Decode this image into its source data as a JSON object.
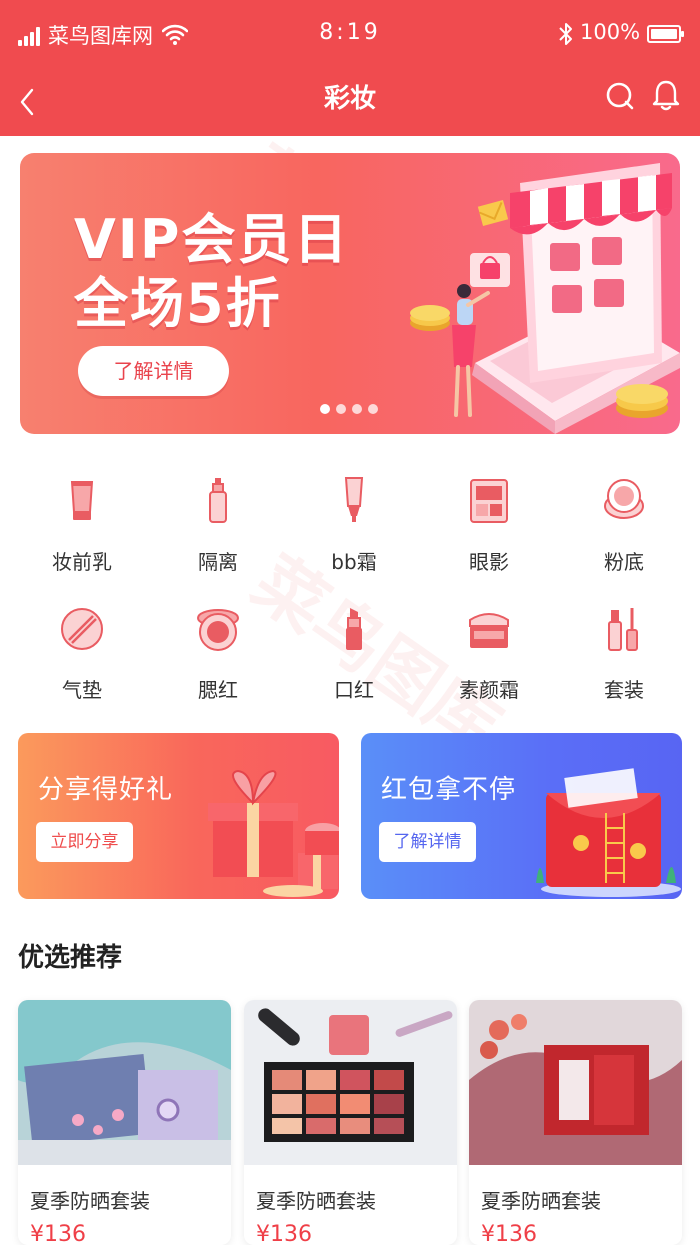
{
  "status_bar": {
    "carrier": "菜鸟图库网",
    "time": "8:19",
    "battery": "100%",
    "battery_level": 1.0
  },
  "header": {
    "title": "彩妆",
    "icons": [
      "back-icon",
      "search-icon",
      "bell-icon"
    ]
  },
  "banner": {
    "line1": "VIP会员日",
    "line2": "全场5折",
    "cta": "了解详情",
    "page_count": 4,
    "active_page": 1
  },
  "categories": [
    {
      "label": "妆前乳",
      "icon": "primer-tube-icon"
    },
    {
      "label": "隔离",
      "icon": "isolation-bottle-icon"
    },
    {
      "label": "bb霜",
      "icon": "bb-cream-icon"
    },
    {
      "label": "眼影",
      "icon": "eyeshadow-palette-icon"
    },
    {
      "label": "粉底",
      "icon": "foundation-compact-icon"
    },
    {
      "label": "气垫",
      "icon": "cushion-icon"
    },
    {
      "label": "腮红",
      "icon": "blush-icon"
    },
    {
      "label": "口红",
      "icon": "lipstick-icon"
    },
    {
      "label": "素颜霜",
      "icon": "cream-jar-icon"
    },
    {
      "label": "套装",
      "icon": "set-icon"
    }
  ],
  "promos": [
    {
      "title": "分享得好礼",
      "button": "立即分享"
    },
    {
      "title": "红包拿不停",
      "button": "了解详情"
    }
  ],
  "section": {
    "title": "优选推荐"
  },
  "products": [
    {
      "name": "夏季防晒套装",
      "price": "¥136"
    },
    {
      "name": "夏季防晒套装",
      "price": "¥136"
    },
    {
      "name": "夏季防晒套装",
      "price": "¥136"
    }
  ],
  "colors": {
    "brand_red": "#f04b4f",
    "price_red": "#ef3f47",
    "promo_blue": "#5a6ef7",
    "icon_red": "#ee6a6c"
  }
}
